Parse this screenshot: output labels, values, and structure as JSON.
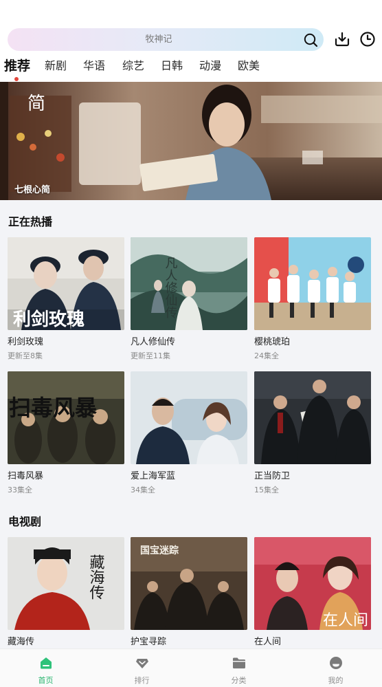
{
  "search": {
    "placeholder": "牧神记"
  },
  "header_icons": [
    "download-icon",
    "history-clock-icon"
  ],
  "tabs": [
    {
      "label": "推荐",
      "active": true
    },
    {
      "label": "新剧"
    },
    {
      "label": "华语"
    },
    {
      "label": "综艺"
    },
    {
      "label": "日韩"
    },
    {
      "label": "动漫"
    },
    {
      "label": "欧美"
    }
  ],
  "banner": {
    "title": "七根心简",
    "overlay_text": "简"
  },
  "sections": [
    {
      "title": "正在热播",
      "items": [
        {
          "title": "利剑玫瑰",
          "sub": "更新至8集",
          "poster_text": "利剑玫瑰"
        },
        {
          "title": "凡人修仙传",
          "sub": "更新至11集",
          "poster_text": "凡人修仙传"
        },
        {
          "title": "樱桃琥珀",
          "sub": "24集全",
          "poster_text": ""
        },
        {
          "title": "扫毒风暴",
          "sub": "33集全",
          "poster_text": "扫毒风暴"
        },
        {
          "title": "爱上海军蓝",
          "sub": "34集全",
          "poster_text": ""
        },
        {
          "title": "正当防卫",
          "sub": "15集全",
          "poster_text": ""
        }
      ]
    },
    {
      "title": "电视剧",
      "items": [
        {
          "title": "藏海传",
          "poster_text": "藏海传"
        },
        {
          "title": "护宝寻踪",
          "poster_text": "国宝迷踪"
        },
        {
          "title": "在人间",
          "poster_text": "在人间"
        }
      ]
    }
  ],
  "bottom_nav": [
    {
      "label": "首页",
      "icon": "home-icon",
      "active": true
    },
    {
      "label": "排行",
      "icon": "ranking-icon"
    },
    {
      "label": "分类",
      "icon": "folder-icon"
    },
    {
      "label": "我的",
      "icon": "profile-icon"
    }
  ],
  "colors": {
    "accent": "#27b46d",
    "tab_dot": "#e2463c"
  }
}
